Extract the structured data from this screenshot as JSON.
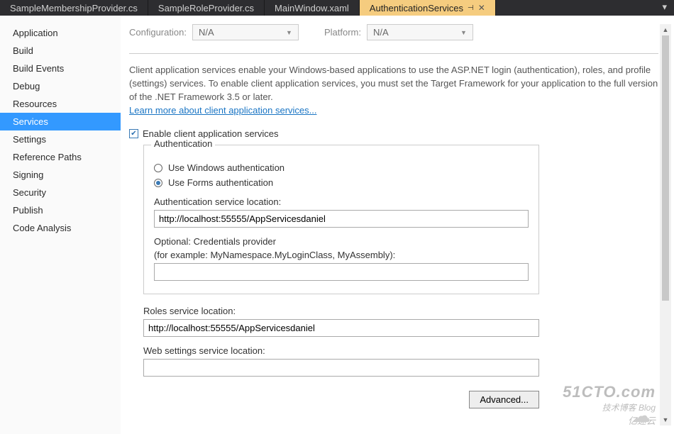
{
  "tabs": [
    {
      "label": "SampleMembershipProvider.cs",
      "active": false
    },
    {
      "label": "SampleRoleProvider.cs",
      "active": false
    },
    {
      "label": "MainWindow.xaml",
      "active": false
    },
    {
      "label": "AuthenticationServices",
      "active": true
    }
  ],
  "sidebar": {
    "items": [
      "Application",
      "Build",
      "Build Events",
      "Debug",
      "Resources",
      "Services",
      "Settings",
      "Reference Paths",
      "Signing",
      "Security",
      "Publish",
      "Code Analysis"
    ],
    "selected_index": 5
  },
  "config": {
    "configuration_label": "Configuration:",
    "configuration_value": "N/A",
    "platform_label": "Platform:",
    "platform_value": "N/A"
  },
  "intro": {
    "text": "Client application services enable your Windows-based applications to use the ASP.NET login (authentication), roles, and profile (settings) services. To enable client application services, you must set the Target Framework for your application to the full version of the .NET Framework 3.5 or later.",
    "link": "Learn more about client application services..."
  },
  "enable": {
    "label": "Enable client application services",
    "checked": true
  },
  "auth": {
    "legend": "Authentication",
    "windows_label": "Use Windows authentication",
    "forms_label": "Use Forms authentication",
    "selected": "forms",
    "service_location_label": "Authentication service location:",
    "service_location_value": "http://localhost:55555/AppServicesdaniel",
    "cred_label1": "Optional: Credentials provider",
    "cred_label2": "(for example: MyNamespace.MyLoginClass, MyAssembly):",
    "cred_value": ""
  },
  "roles": {
    "label": "Roles service location:",
    "value": "http://localhost:55555/AppServicesdaniel"
  },
  "websettings": {
    "label": "Web settings service location:",
    "value": ""
  },
  "advanced": {
    "label": "Advanced..."
  },
  "watermark": {
    "line1": "51CTO.com",
    "line2": "技术博客  Blog",
    "line3": "亿速云"
  }
}
